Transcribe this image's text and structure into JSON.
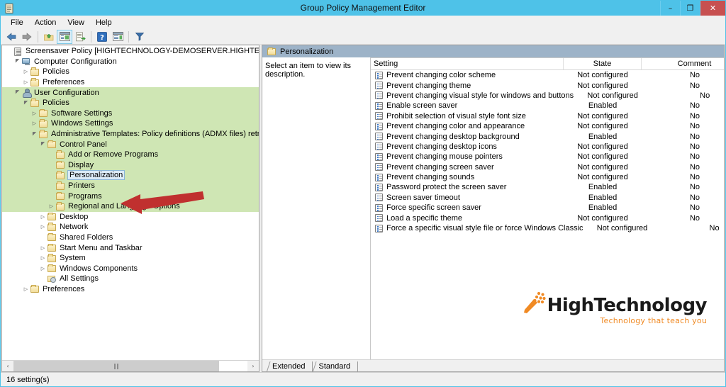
{
  "window": {
    "title": "Group Policy Management Editor",
    "app_icon": "console-document-icon",
    "minimize_label": "–",
    "maximize_label": "❐",
    "close_label": "✕"
  },
  "menubar": {
    "items": [
      {
        "label": "File"
      },
      {
        "label": "Action"
      },
      {
        "label": "View"
      },
      {
        "label": "Help"
      }
    ]
  },
  "toolbar": {
    "buttons": [
      {
        "name": "back-icon",
        "glyph": "←"
      },
      {
        "name": "forward-icon",
        "glyph": "→"
      },
      {
        "name": "up-one-level-icon",
        "glyph": ""
      },
      {
        "name": "show-hide-console-tree-icon",
        "glyph": ""
      },
      {
        "name": "export-list-icon",
        "glyph": ""
      },
      {
        "name": "help-icon",
        "glyph": "?"
      },
      {
        "name": "show-hide-action-pane-icon",
        "glyph": ""
      },
      {
        "name": "filter-icon",
        "glyph": ""
      }
    ]
  },
  "tree": {
    "root": {
      "label": "Screensaver Policy [HIGHTECHNOLOGY-DEMOSERVER.HIGHTECHNOLOGY.IN] Policy",
      "icon": "console-root-icon",
      "indent": 0,
      "twisty": "",
      "highlighted": false,
      "selected": false
    },
    "items": [
      {
        "label": "Computer Configuration",
        "icon": "computer-icon",
        "indent": 1,
        "twisty": "expanded",
        "highlighted": false,
        "selected": false
      },
      {
        "label": "Policies",
        "icon": "folder-icon",
        "indent": 2,
        "twisty": "collapsed",
        "highlighted": false,
        "selected": false
      },
      {
        "label": "Preferences",
        "icon": "folder-icon",
        "indent": 2,
        "twisty": "collapsed",
        "highlighted": false,
        "selected": false
      },
      {
        "label": "User Configuration",
        "icon": "user-icon",
        "indent": 1,
        "twisty": "expanded",
        "highlighted": true,
        "selected": false
      },
      {
        "label": "Policies",
        "icon": "folder-icon",
        "indent": 2,
        "twisty": "expanded",
        "highlighted": true,
        "selected": false
      },
      {
        "label": "Software Settings",
        "icon": "folder-icon",
        "indent": 3,
        "twisty": "collapsed",
        "highlighted": true,
        "selected": false
      },
      {
        "label": "Windows Settings",
        "icon": "folder-icon",
        "indent": 3,
        "twisty": "collapsed",
        "highlighted": true,
        "selected": false
      },
      {
        "label": "Administrative Templates: Policy definitions (ADMX files) retrieved from the",
        "icon": "folder-icon",
        "indent": 3,
        "twisty": "expanded",
        "highlighted": true,
        "selected": false
      },
      {
        "label": "Control Panel",
        "icon": "folder-icon",
        "indent": 4,
        "twisty": "expanded",
        "highlighted": true,
        "selected": false
      },
      {
        "label": "Add or Remove Programs",
        "icon": "folder-icon",
        "indent": 5,
        "twisty": "",
        "highlighted": true,
        "selected": false
      },
      {
        "label": "Display",
        "icon": "folder-icon",
        "indent": 5,
        "twisty": "",
        "highlighted": true,
        "selected": false
      },
      {
        "label": "Personalization",
        "icon": "folder-icon",
        "indent": 5,
        "twisty": "",
        "highlighted": true,
        "selected": true
      },
      {
        "label": "Printers",
        "icon": "folder-icon",
        "indent": 5,
        "twisty": "",
        "highlighted": true,
        "selected": false
      },
      {
        "label": "Programs",
        "icon": "folder-icon",
        "indent": 5,
        "twisty": "",
        "highlighted": true,
        "selected": false
      },
      {
        "label": "Regional and Language Options",
        "icon": "folder-icon",
        "indent": 5,
        "twisty": "collapsed",
        "highlighted": true,
        "selected": false
      },
      {
        "label": "Desktop",
        "icon": "folder-icon",
        "indent": 4,
        "twisty": "collapsed",
        "highlighted": false,
        "selected": false
      },
      {
        "label": "Network",
        "icon": "folder-icon",
        "indent": 4,
        "twisty": "collapsed",
        "highlighted": false,
        "selected": false
      },
      {
        "label": "Shared Folders",
        "icon": "folder-icon",
        "indent": 4,
        "twisty": "",
        "highlighted": false,
        "selected": false
      },
      {
        "label": "Start Menu and Taskbar",
        "icon": "folder-icon",
        "indent": 4,
        "twisty": "collapsed",
        "highlighted": false,
        "selected": false
      },
      {
        "label": "System",
        "icon": "folder-icon",
        "indent": 4,
        "twisty": "collapsed",
        "highlighted": false,
        "selected": false
      },
      {
        "label": "Windows Components",
        "icon": "folder-icon",
        "indent": 4,
        "twisty": "collapsed",
        "highlighted": false,
        "selected": false
      },
      {
        "label": "All Settings",
        "icon": "all-settings-icon",
        "indent": 4,
        "twisty": "",
        "highlighted": false,
        "selected": false
      },
      {
        "label": "Preferences",
        "icon": "folder-icon",
        "indent": 2,
        "twisty": "collapsed",
        "highlighted": false,
        "selected": false
      }
    ],
    "scrollbar": {
      "left_arrow": "‹",
      "right_arrow": "›",
      "grip": "‖‖"
    }
  },
  "annotation": {
    "arrow_color": "#c02f2f",
    "arrow_name": "red-pointer-arrow"
  },
  "right_pane": {
    "tab_title": "Personalization",
    "tab_icon": "folder-icon",
    "description_placeholder": "Select an item to view its description.",
    "columns": [
      {
        "key": "setting",
        "label": "Setting"
      },
      {
        "key": "state",
        "label": "State"
      },
      {
        "key": "comment",
        "label": "Comment"
      }
    ],
    "rows": [
      {
        "setting": "Prevent changing color scheme",
        "state": "Not configured",
        "comment": "No"
      },
      {
        "setting": "Prevent changing theme",
        "state": "Not configured",
        "comment": "No"
      },
      {
        "setting": "Prevent changing visual style for windows and buttons",
        "state": "Not configured",
        "comment": "No"
      },
      {
        "setting": "Enable screen saver",
        "state": "Enabled",
        "comment": "No"
      },
      {
        "setting": "Prohibit selection of visual style font size",
        "state": "Not configured",
        "comment": "No"
      },
      {
        "setting": "Prevent changing color and appearance",
        "state": "Not configured",
        "comment": "No"
      },
      {
        "setting": "Prevent changing desktop background",
        "state": "Enabled",
        "comment": "No"
      },
      {
        "setting": "Prevent changing desktop icons",
        "state": "Not configured",
        "comment": "No"
      },
      {
        "setting": "Prevent changing mouse pointers",
        "state": "Not configured",
        "comment": "No"
      },
      {
        "setting": "Prevent changing screen saver",
        "state": "Not configured",
        "comment": "No"
      },
      {
        "setting": "Prevent changing sounds",
        "state": "Not configured",
        "comment": "No"
      },
      {
        "setting": "Password protect the screen saver",
        "state": "Enabled",
        "comment": "No"
      },
      {
        "setting": "Screen saver timeout",
        "state": "Enabled",
        "comment": "No"
      },
      {
        "setting": "Force specific screen saver",
        "state": "Enabled",
        "comment": "No"
      },
      {
        "setting": "Load a specific theme",
        "state": "Not configured",
        "comment": "No"
      },
      {
        "setting": "Force a specific visual style file or force Windows Classic",
        "state": "Not configured",
        "comment": "No"
      }
    ],
    "view_tabs": [
      {
        "label": "Extended",
        "selected": false
      },
      {
        "label": "Standard",
        "selected": true
      }
    ],
    "watermark": {
      "brand_part1": "High",
      "brand_part2": "Technology",
      "tagline": "Technology that teach you",
      "accent_color": "#f08a24"
    }
  },
  "statusbar": {
    "text": "16 setting(s)"
  }
}
